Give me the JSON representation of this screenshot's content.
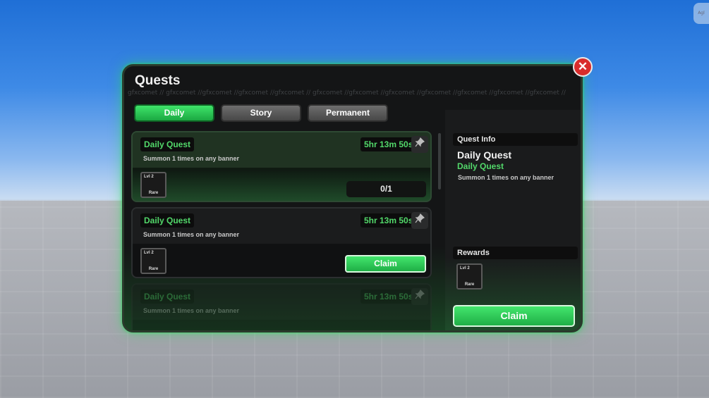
{
  "corner_badge": "Agl",
  "quests_panel": {
    "title": "Quests",
    "watermark": "gfxcomet // gfxcomet //gfxcomet //gfxcomet //gfxcomet // gfxcomet //gfxcomet //gfxcomet //gfxcomet //gfxcomet //gfxcomet //gfxcomet //",
    "close_glyph": "✕",
    "tabs": [
      {
        "label": "Daily",
        "active": true
      },
      {
        "label": "Story",
        "active": false
      },
      {
        "label": "Permanent",
        "active": false
      }
    ],
    "quests": [
      {
        "name": "Daily Quest",
        "description": "Summon 1 times on any banner",
        "timer": "5hr 13m 50s",
        "reward": {
          "level": "Lvl 2",
          "rarity": "Rare"
        },
        "progress": "0/1"
      },
      {
        "name": "Daily Quest",
        "description": "Summon 1 times on any banner",
        "timer": "5hr 13m 50s",
        "reward": {
          "level": "Lvl 2",
          "rarity": "Rare"
        },
        "action": "Claim"
      },
      {
        "name": "Daily Quest",
        "description": "Summon 1 times on any banner",
        "timer": "5hr 13m 50s"
      }
    ],
    "pin_icon": "pin-icon"
  },
  "quest_info": {
    "header": "Quest Info",
    "title": "Daily Quest",
    "subtitle": "Daily Quest",
    "description": "Summon 1 times on any banner",
    "rewards_header": "Rewards",
    "reward": {
      "level": "Lvl 2",
      "rarity": "Rare"
    },
    "claim_label": "Claim"
  },
  "colors": {
    "accent_green": "#52d86a",
    "claim_green": "#2fcf57",
    "close_red": "#d92c2c"
  }
}
